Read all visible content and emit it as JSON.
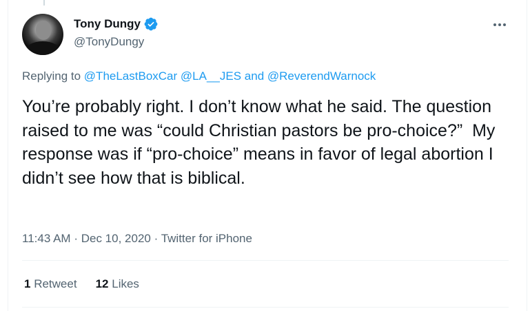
{
  "tweet": {
    "author": {
      "display_name": "Tony Dungy",
      "handle": "@TonyDungy",
      "verified": true
    },
    "replying_to": {
      "prefix": "Replying to",
      "mention_1": "@TheLastBoxCar",
      "mention_2": "@LA__JES",
      "conjunction": "and",
      "mention_3": "@ReverendWarnock"
    },
    "text": "You’re probably right. I don’t know what he said. The question raised to me was “could Christian pastors be pro-choice?”  My response was if “pro-choice” means in favor of legal abortion I didn’t see how that is biblical.",
    "time": "11:43 AM",
    "separator": "·",
    "date": "Dec 10, 2020",
    "source": "Twitter for iPhone",
    "stats": {
      "retweets_count": "1",
      "retweets_label": "Retweet",
      "likes_count": "12",
      "likes_label": "Likes"
    }
  },
  "colors": {
    "accent": "#1d9bf0",
    "secondary_text": "#536471",
    "primary_text": "#0f1419",
    "divider": "#eff3f4"
  },
  "icons": {
    "verified": "verified-badge-icon",
    "more": "more-horizontal-icon"
  }
}
